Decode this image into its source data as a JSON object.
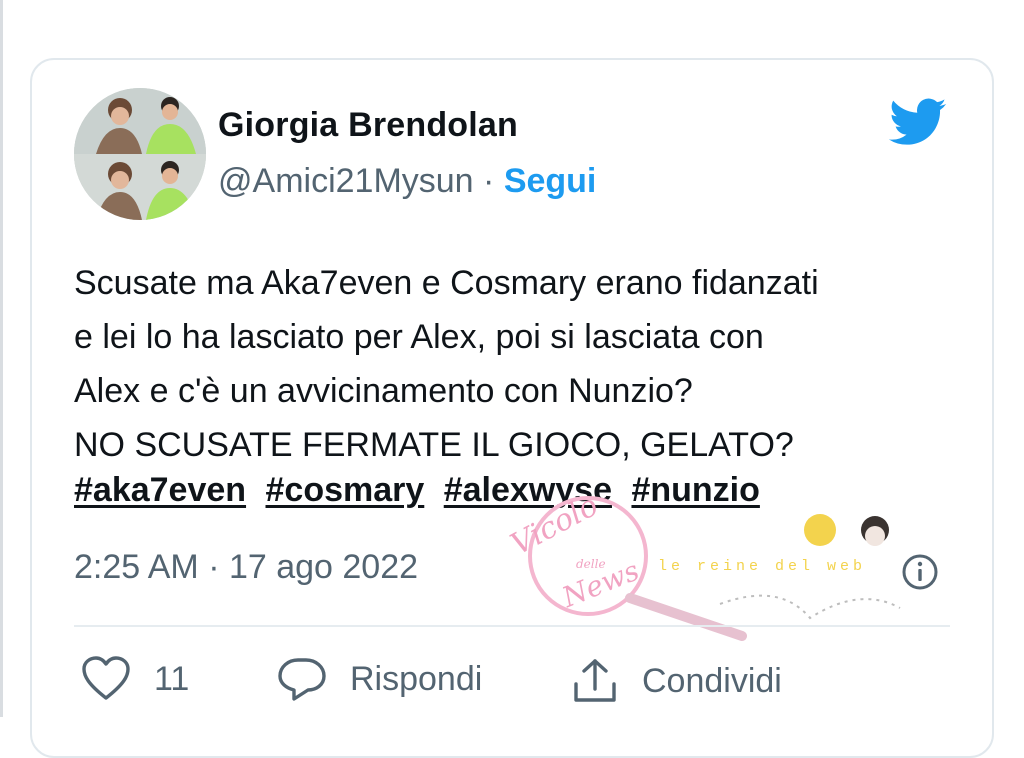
{
  "tweet": {
    "author_name": "Giorgia Brendolan",
    "handle": "@Amici21Mysun",
    "separator": " · ",
    "follow_label": "Segui",
    "text_lines": [
      "Scusate ma Aka7even e Cosmary erano fidanzati",
      "e lei lo ha lasciato per Alex, poi si lasciata con",
      "Alex e c'è un avvicinamento con Nunzio?",
      "NO SCUSATE FERMATE IL GIOCO, GELATO?"
    ],
    "hashtags": [
      "#aka7even",
      "#cosmary",
      "#alexwyse",
      "#nunzio"
    ],
    "timestamp": "2:25 AM · 17 ago 2022",
    "actions": {
      "like_count": "11",
      "reply_label": "Rispondi",
      "share_label": "Condividi"
    }
  },
  "watermark": {
    "logo_text_1": "Vicolo",
    "logo_text_2": "delle",
    "logo_text_3": "News",
    "band_text": "le reine del web"
  },
  "icons": {
    "brand": "twitter-bird-icon",
    "info": "info-icon",
    "like": "heart-icon",
    "reply": "speech-bubble-icon",
    "share": "share-icon"
  },
  "colors": {
    "accent": "#1d9bf0",
    "text": "#0f1419",
    "secondary": "#536471",
    "border": "#e1e8ed"
  }
}
